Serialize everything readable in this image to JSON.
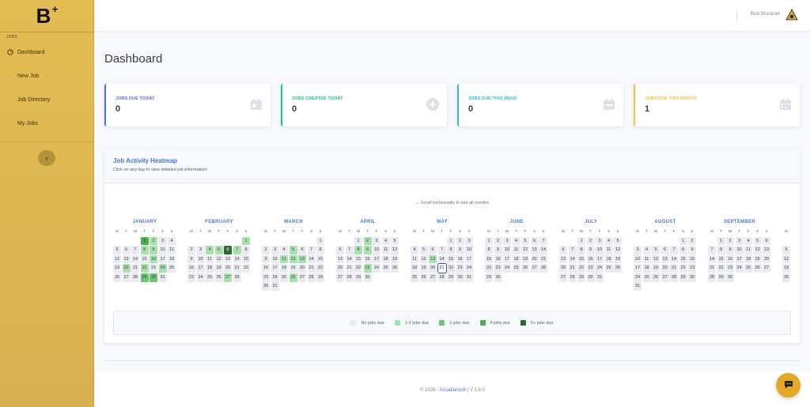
{
  "sidebar": {
    "brand": "B",
    "brand_plus": "+",
    "heading": "JOBS",
    "items": [
      {
        "label": "Dashboard",
        "icon": "gauge-icon"
      },
      {
        "label": "New Job",
        "icon": "doc-icon"
      },
      {
        "label": "Job Directory",
        "icon": "folder-icon"
      },
      {
        "label": "My Jobs",
        "icon": "list-icon"
      }
    ],
    "toggle": "‹"
  },
  "topbar": {
    "user_name": "Rick Bruckner"
  },
  "page_title": "Dashboard",
  "cards": [
    {
      "label": "JOBS DUE TODAY",
      "value": "0",
      "color": "#4e73df"
    },
    {
      "label": "JOBS CREATED TODAY",
      "value": "0",
      "color": "#1cc88a"
    },
    {
      "label": "JOBS DUE THIS WEEK",
      "value": "0",
      "color": "#36b9cc"
    },
    {
      "label": "JOBS DUE THIS MONTH",
      "value": "1",
      "color": "#f6c23e"
    }
  ],
  "heatmap": {
    "title": "Job Activity Heatmap",
    "subtitle": "Click on any day to view detailed job information!",
    "scroll_hint": "↔ Scroll horizontally to see all months",
    "weekdays": [
      "M",
      "T",
      "W",
      "T",
      "F",
      "S",
      "S"
    ],
    "months": [
      {
        "name": "JANUARY",
        "offset": 3,
        "days": 31,
        "levels": {
          "1": 3,
          "2": 1,
          "8": 1,
          "9": 1,
          "16": 1,
          "20": 1,
          "22": 1,
          "24": 1,
          "29": 2,
          "30": 2
        }
      },
      {
        "name": "FEBRUARY",
        "offset": 6,
        "days": 28,
        "levels": {
          "1": 1,
          "4": 1,
          "5": 1,
          "6": 4,
          "7": 1,
          "27": 1
        }
      },
      {
        "name": "MARCH",
        "offset": 6,
        "days": 31,
        "levels": {
          "5": 1,
          "11": 1,
          "12": 1,
          "13": 1,
          "26": 1
        }
      },
      {
        "name": "APRIL",
        "offset": 2,
        "days": 30,
        "levels": {
          "2": 1,
          "8": 1,
          "9": 1,
          "23": 1
        }
      },
      {
        "name": "MAY",
        "offset": 4,
        "days": 31,
        "levels": {
          "13": 1
        },
        "today": 21
      },
      {
        "name": "JUNE",
        "offset": 0,
        "days": 30,
        "levels": {}
      },
      {
        "name": "JULY",
        "offset": 2,
        "days": 31,
        "levels": {}
      },
      {
        "name": "AUGUST",
        "offset": 5,
        "days": 31,
        "levels": {}
      },
      {
        "name": "SEPTEMBER",
        "offset": 1,
        "days": 30,
        "levels": {}
      }
    ],
    "partial_month": {
      "weekday": "M",
      "days": [
        "5",
        "12",
        "19",
        "26"
      ]
    },
    "legend": [
      {
        "label": "No jobs due",
        "color": "#e9ebf0"
      },
      {
        "label": "1-2 jobs due",
        "color": "#a7e2ad"
      },
      {
        "label": "3 jobs due",
        "color": "#6cc775"
      },
      {
        "label": "4 jobs due",
        "color": "#4caf50"
      },
      {
        "label": "5+ jobs due",
        "color": "#2e6b30"
      }
    ]
  },
  "footer": {
    "prefix": "© 2026 - ",
    "brand": "Arcadiansoft",
    "suffix": " | V 1.6.0"
  }
}
